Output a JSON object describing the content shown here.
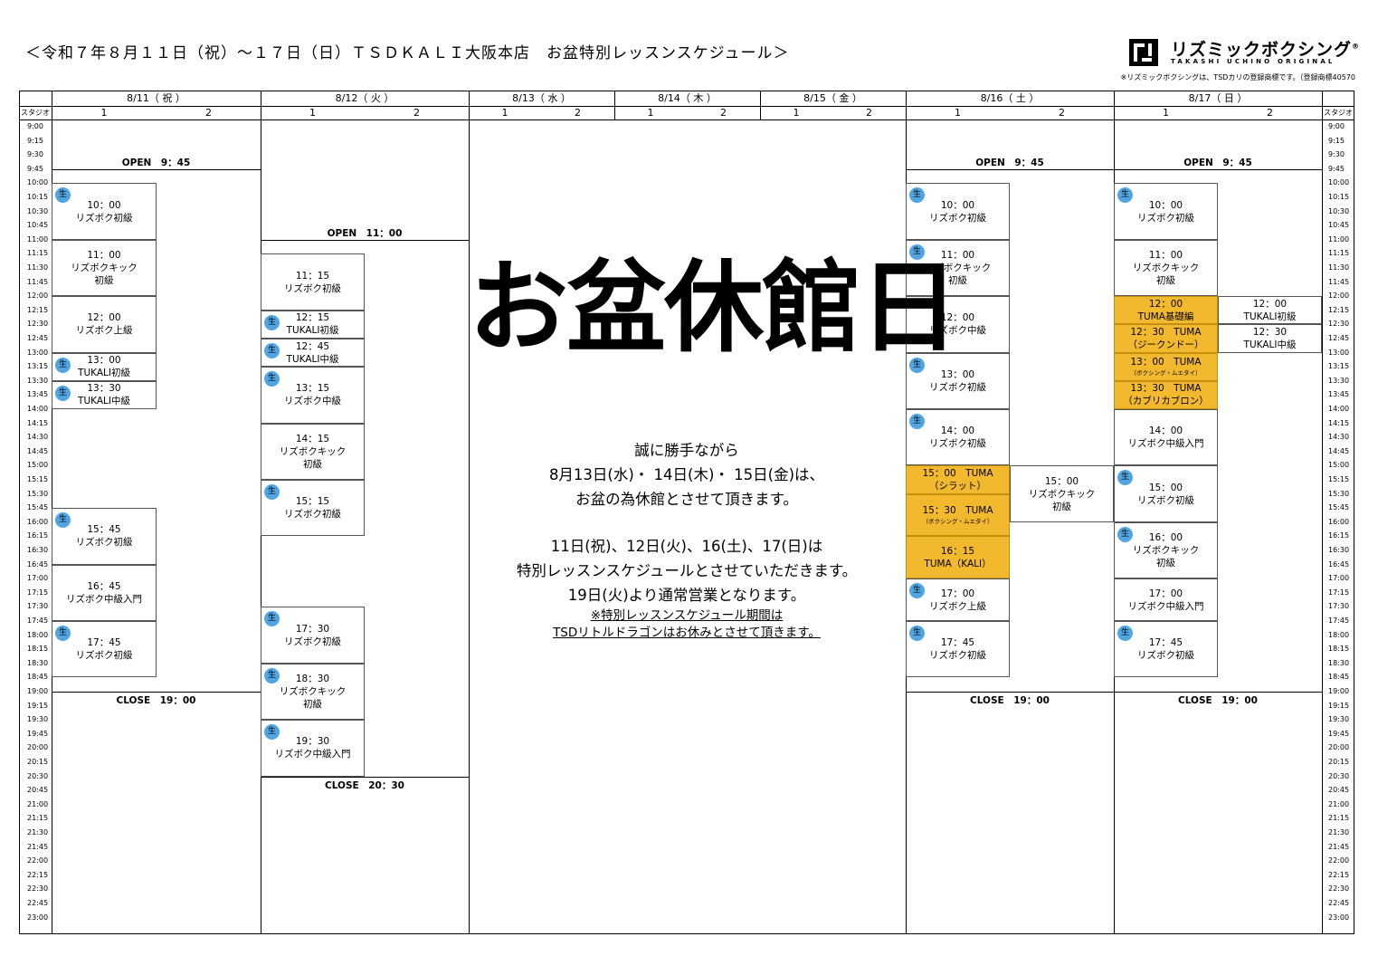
{
  "title": "＜令和７年８月１１日（祝）〜１７日（日）ＴＳＤＫＡＬＩ大阪本店　お盆特別レッスンスケジュール＞",
  "brand": {
    "name": "リズミックボクシング",
    "registered_mark": "®",
    "subtitle": "TAKASHI UCHINO ORIGINAL",
    "trademark_note": "※リズミックボクシングは、TSDカリの登録商標です。（登録商標40570"
  },
  "studio_label": "スタジオ",
  "days": [
    {
      "label": "8/11（ 祝 ）",
      "studios": [
        "1",
        "2"
      ]
    },
    {
      "label": "8/12（ 火 ）",
      "studios": [
        "1",
        "2"
      ]
    },
    {
      "label": "8/13（ 水 ）",
      "studios": [
        "1",
        "2"
      ]
    },
    {
      "label": "8/14（ 木 ）",
      "studios": [
        "1",
        "2"
      ]
    },
    {
      "label": "8/15（ 金 ）",
      "studios": [
        "1",
        "2"
      ]
    },
    {
      "label": "8/16（ 土 ）",
      "studios": [
        "1",
        "2"
      ]
    },
    {
      "label": "8/17（ 日 ）",
      "studios": [
        "1",
        "2"
      ]
    }
  ],
  "times": [
    "9:00",
    "9:15",
    "9:30",
    "9:45",
    "10:00",
    "10:15",
    "10:30",
    "10:45",
    "11:00",
    "11:15",
    "11:30",
    "11:45",
    "12:00",
    "12:15",
    "12:30",
    "12:45",
    "13:00",
    "13:15",
    "13:30",
    "13:45",
    "14:00",
    "14:15",
    "14:30",
    "14:45",
    "15:00",
    "15:15",
    "15:30",
    "15:45",
    "16:00",
    "16:15",
    "16:30",
    "16:45",
    "17:00",
    "17:15",
    "17:30",
    "17:45",
    "18:00",
    "18:15",
    "18:30",
    "18:45",
    "19:00",
    "19:15",
    "19:30",
    "19:45",
    "20:00",
    "20:15",
    "20:30",
    "20:45",
    "21:00",
    "21:15",
    "21:30",
    "21:45",
    "22:00",
    "22:15",
    "22:30",
    "22:45",
    "23:00"
  ],
  "live_badge": "生",
  "markers": {
    "d11_open": "OPEN　9：45",
    "d11_close": "CLOSE　19：00",
    "d12_open": "OPEN　11：00",
    "d12_close": "CLOSE　20：30",
    "d16_open": "OPEN　9：45",
    "d16_close": "CLOSE　19：00",
    "d17_open": "OPEN　9：45",
    "d17_close": "CLOSE　19：00"
  },
  "lessons": {
    "d11": [
      {
        "time": "10：00",
        "name": "リズボク初級",
        "live": true
      },
      {
        "time": "11：00",
        "name": "リズボクキック",
        "level": "初級",
        "live": false
      },
      {
        "time": "12：00",
        "name": "リズボク上級",
        "live": false
      },
      {
        "time": "13：00",
        "name": "TUKALI初級",
        "live": true
      },
      {
        "time": "13：30",
        "name": "TUKALI中級",
        "live": true
      },
      {
        "time": "15：45",
        "name": "リズボク初級",
        "live": true
      },
      {
        "time": "16：45",
        "name": "リズボク中級入門",
        "live": false
      },
      {
        "time": "17：45",
        "name": "リズボク初級",
        "live": true
      }
    ],
    "d12": [
      {
        "time": "11：15",
        "name": "リズボク初級",
        "live": false
      },
      {
        "time": "12：15",
        "name": "TUKALI初級",
        "live": true
      },
      {
        "time": "12：45",
        "name": "TUKALI中級",
        "live": true
      },
      {
        "time": "13：15",
        "name": "リズボク中級",
        "live": true
      },
      {
        "time": "14：15",
        "name": "リズボクキック",
        "level": "初級",
        "live": false
      },
      {
        "time": "15：15",
        "name": "リズボク初級",
        "live": true
      },
      {
        "time": "17：30",
        "name": "リズボク初級",
        "live": true
      },
      {
        "time": "18：30",
        "name": "リズボクキック",
        "level": "初級",
        "live": true
      },
      {
        "time": "19：30",
        "name": "リズボク中級入門",
        "live": true
      }
    ],
    "d16_s1": [
      {
        "time": "10：00",
        "name": "リズボク初級",
        "live": true
      },
      {
        "time": "11：00",
        "name": "リズボクキック",
        "level": "初級",
        "live": true
      },
      {
        "time": "12：00",
        "name": "リズボク中級",
        "live": false
      },
      {
        "time": "13：00",
        "name": "リズボク初級",
        "live": true
      },
      {
        "time": "14：00",
        "name": "リズボク初級",
        "live": true
      },
      {
        "time": "15：00　TUMA",
        "name": "（シラット）",
        "live": false,
        "highlight": true
      },
      {
        "time": "15：30　TUMA",
        "name": "（ボクシング・ムエタイ）",
        "live": false,
        "highlight": true,
        "small": true
      },
      {
        "time": "16：15",
        "name": "TUMA（KALI）",
        "live": false,
        "highlight": true
      },
      {
        "time": "17：00",
        "name": "リズボク上級",
        "live": true
      },
      {
        "time": "17：45",
        "name": "リズボク初級",
        "live": true
      }
    ],
    "d16_s2": [
      {
        "time": "15：00",
        "name": "リズボクキック",
        "level": "初級",
        "live": false
      }
    ],
    "d17_s1": [
      {
        "time": "10：00",
        "name": "リズボク初級",
        "live": true
      },
      {
        "time": "11：00",
        "name": "リズボクキック",
        "level": "初級",
        "live": false
      },
      {
        "time": "12：00",
        "name": "TUMA基礎編",
        "live": false,
        "highlight": true
      },
      {
        "time": "12：30　TUMA",
        "name": "（ジークンドー）",
        "live": false,
        "highlight": true
      },
      {
        "time": "13：00　TUMA",
        "name": "（ボクシング・ムエタイ）",
        "live": false,
        "highlight": true,
        "small": true
      },
      {
        "time": "13：30　TUMA",
        "name": "（カブリカブロン）",
        "live": false,
        "highlight": true
      },
      {
        "time": "14：00",
        "name": "リズボク中級入門",
        "live": false
      },
      {
        "time": "15：00",
        "name": "リズボク初級",
        "live": true
      },
      {
        "time": "16：00",
        "name": "リズボクキック",
        "level": "初級",
        "live": true
      },
      {
        "time": "17：00",
        "name": "リズボク中級入門",
        "live": false
      },
      {
        "time": "17：45",
        "name": "リズボク初級",
        "live": true
      }
    ],
    "d17_s2": [
      {
        "time": "12：00",
        "name": "TUKALI初級",
        "live": false
      },
      {
        "time": "12：30",
        "name": "TUKALI中級",
        "live": false
      }
    ]
  },
  "closed": {
    "title": "お盆休館日",
    "line1": "誠に勝手ながら",
    "line2": "8月13日(水)・ 14日(木)・ 15日(金)は、",
    "line3": "お盆の為休館とさせて頂きます。",
    "line4": "11日(祝)、12日(火)、16(土)、17(日)は",
    "line5": "特別レッスンスケジュールとさせていただきます。",
    "line6": "19日(火)より通常営業となります。",
    "note1": "※特別レッスンスケジュール期間は",
    "note2": "TSDリトルドラゴンはお休みとさせて頂きます。"
  }
}
